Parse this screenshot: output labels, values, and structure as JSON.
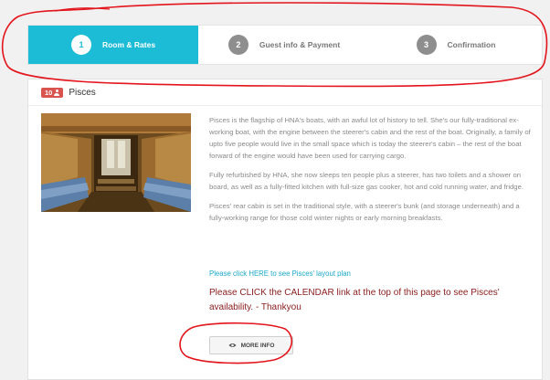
{
  "steps": [
    {
      "number": "1",
      "label": "Room & Rates",
      "active": true
    },
    {
      "number": "2",
      "label": "Guest info & Payment",
      "active": false
    },
    {
      "number": "3",
      "label": "Confirmation",
      "active": false
    }
  ],
  "room": {
    "capacity": "10",
    "name": "Pisces",
    "description": [
      "Pisces is the flagship of HNA's boats, with an awful lot of history to tell. She's our fully-traditional ex-working boat, with the engine between the steerer's cabin and the rest of the boat. Originally, a family of upto five people would live in the small space which is today the steerer's cabin – the rest of the boat forward of the engine would have been used for carrying cargo.",
      "Fully refurbished by HNA, she now sleeps ten people plus a steerer, has two toilets and a shower on board, as well as a fully-fitted kitchen with full-size gas cooker, hot and cold running water, and fridge.",
      "Pisces' rear cabin is set in the traditional style, with a steerer's bunk (and storage underneath) and a fully-working range for those cold winter nights or early morning breakfasts."
    ],
    "layout_link": "Please click HERE to see Pisces' layout plan",
    "calendar_note": "Please CLICK the CALENDAR link at the top of this page to see Pisces' availability. - Thankyou",
    "more_info_label": "MORE INFO"
  },
  "colors": {
    "accent": "#1cbbd6",
    "badge": "#d9534f",
    "note": "#8b1d1d",
    "annotation": "#e3141b"
  },
  "icons": {
    "capacity": "person-icon",
    "more_info": "eye-icon"
  }
}
